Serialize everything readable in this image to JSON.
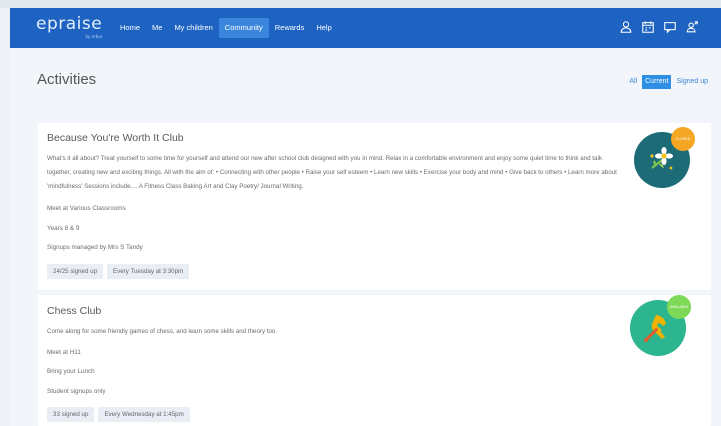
{
  "logo": {
    "name": "epraise",
    "tagline": "by Arbor"
  },
  "nav": {
    "items": [
      "Home",
      "Me",
      "My children",
      "Community",
      "Rewards",
      "Help"
    ],
    "active": "Community",
    "icons": [
      "user-icon",
      "calendar-icon",
      "chat-icon",
      "switch-user-icon"
    ]
  },
  "page": {
    "title": "Activities"
  },
  "filters": {
    "all": "All",
    "current": "Current",
    "signed_up": "Signed up",
    "active": "Current"
  },
  "activities": [
    {
      "title": "Because You're Worth It Club",
      "description": "What's it all about? Treat yourself to some time for yourself and attend our new after school club designed with you in mind. Relax in a comfortable environment and enjoy some quiet time to think and talk together, creating new and exciting things. All with the aim of: • Connecting with other people • Raise your self esteem • Learn new skills • Exercise your body and mind • Give back to others • Learn more about 'mindfulness' Sessions include.... A Fitness Class Baking Art and Clay Poetry/ Journal Writing.",
      "location": "Meet at Various Classrooms",
      "years": "Years 8 & 9",
      "signups": "Signups managed by Mrs S Tandy",
      "signed_up": "24/25 signed up",
      "schedule": "Every Tuesday at 3:30pm",
      "status": "CLOSED",
      "badge_color": "#1e6b78",
      "flag_color": "#f5a623",
      "icon": "flower-icon"
    },
    {
      "title": "Chess Club",
      "description": "Come along for some friendly games of chess, and learn some skills and theory too.",
      "location": "Meet at H11",
      "years": "Bring your Lunch",
      "signups": "Student signups only",
      "signed_up": "33 signed up",
      "schedule": "Every Wednesday at 1:45pm",
      "status": "AVAILABLE",
      "badge_color": "#2db58f",
      "flag_color": "#7ed957",
      "icon": "chess-knight-icon"
    }
  ]
}
